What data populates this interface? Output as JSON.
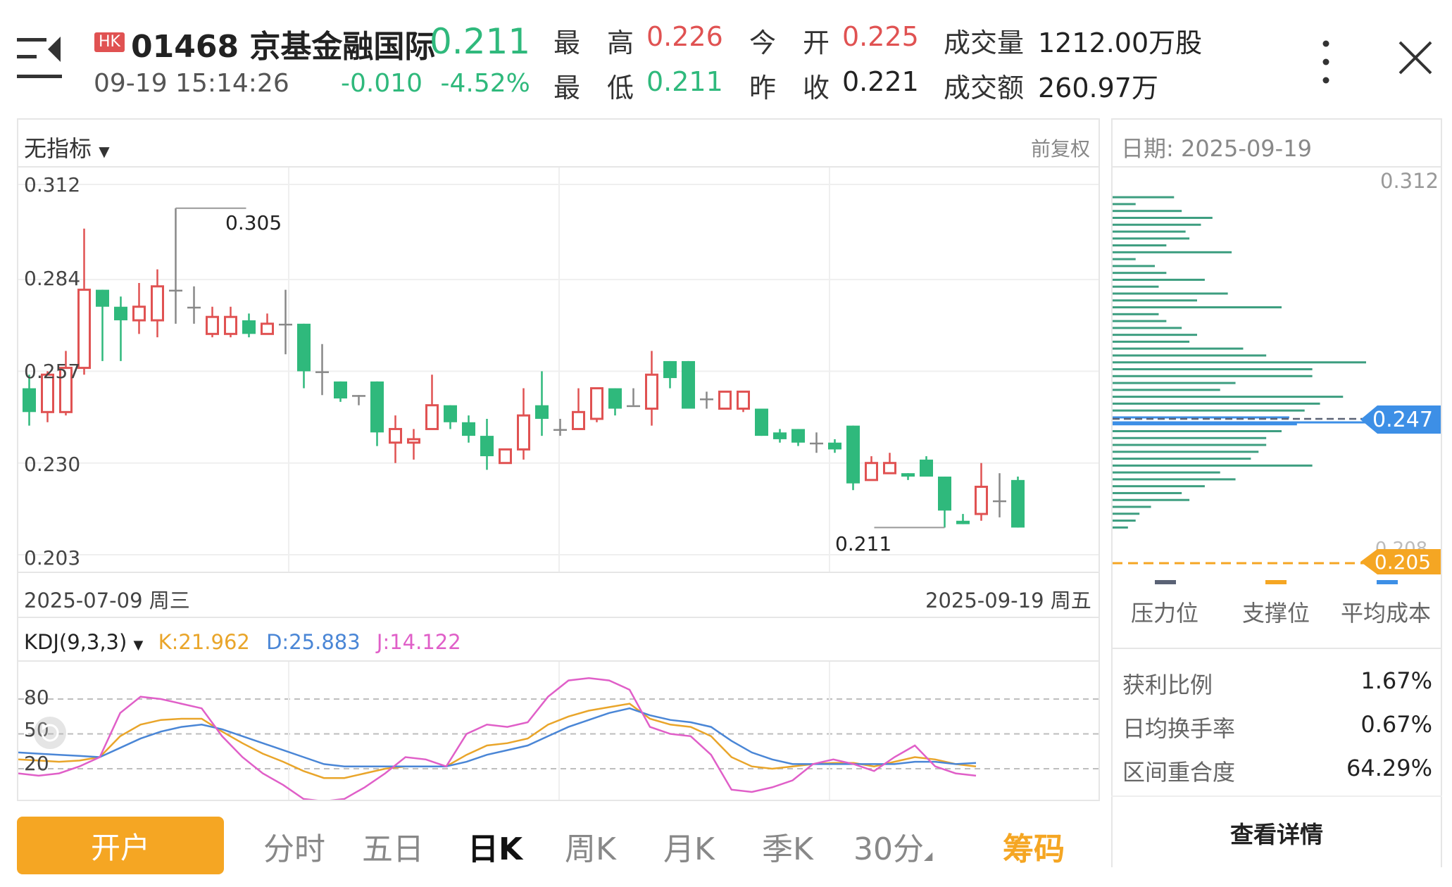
{
  "header": {
    "market_badge": "HK",
    "title": "01468 京基金融国际",
    "price": "0.211",
    "time": "09-19 15:14:26",
    "change": "-0.010",
    "change_pct": "-4.52%",
    "quotes": {
      "high_label": "最　高",
      "high": "0.226",
      "open_label": "今　开",
      "open": "0.225",
      "low_label": "最　低",
      "low": "0.211",
      "prev_close_label": "昨　收",
      "prev_close": "0.221",
      "volume_label": "成交量",
      "volume": "1212.00万股",
      "turnover_label": "成交额",
      "turnover": "260.97万"
    }
  },
  "chart_toolbar": {
    "indicator": "无指标",
    "adjust": "前复权"
  },
  "chart_data": [
    {
      "type": "candlestick",
      "y_ticks": [
        "0.312",
        "0.284",
        "0.257",
        "0.230",
        "0.203"
      ],
      "ylim": [
        0.203,
        0.312
      ],
      "x_start_label": "2025-07-09 周三",
      "x_end_label": "2025-09-19 周五",
      "high_marker": "0.305",
      "low_marker": "0.211",
      "candles": [
        [
          0.252,
          0.245,
          0.256,
          0.241
        ],
        [
          0.245,
          0.256,
          0.257,
          0.242
        ],
        [
          0.245,
          0.258,
          0.263,
          0.244
        ],
        [
          0.258,
          0.281,
          0.299,
          0.256
        ],
        [
          0.281,
          0.276,
          0.281,
          0.26
        ],
        [
          0.276,
          0.272,
          0.279,
          0.26
        ],
        [
          0.272,
          0.276,
          0.283,
          0.268
        ],
        [
          0.272,
          0.282,
          0.287,
          0.267
        ],
        [
          0.281,
          0.281,
          0.305,
          0.271
        ],
        [
          0.276,
          0.276,
          0.282,
          0.271
        ],
        [
          0.268,
          0.273,
          0.276,
          0.267
        ],
        [
          0.268,
          0.273,
          0.276,
          0.267
        ],
        [
          0.272,
          0.268,
          0.274,
          0.267
        ],
        [
          0.268,
          0.271,
          0.274,
          0.268
        ],
        [
          0.271,
          0.271,
          0.281,
          0.262
        ],
        [
          0.271,
          0.257,
          0.271,
          0.252
        ],
        [
          0.257,
          0.257,
          0.265,
          0.25
        ],
        [
          0.254,
          0.249,
          0.254,
          0.248
        ],
        [
          0.25,
          0.25,
          0.25,
          0.247
        ],
        [
          0.254,
          0.239,
          0.254,
          0.235
        ],
        [
          0.236,
          0.24,
          0.244,
          0.23
        ],
        [
          0.236,
          0.237,
          0.24,
          0.231
        ],
        [
          0.24,
          0.247,
          0.256,
          0.24
        ],
        [
          0.247,
          0.242,
          0.247,
          0.24
        ],
        [
          0.242,
          0.238,
          0.244,
          0.236
        ],
        [
          0.238,
          0.232,
          0.243,
          0.228
        ],
        [
          0.23,
          0.234,
          0.234,
          0.23
        ],
        [
          0.234,
          0.244,
          0.252,
          0.231
        ],
        [
          0.247,
          0.243,
          0.257,
          0.238
        ],
        [
          0.24,
          0.24,
          0.243,
          0.238
        ],
        [
          0.24,
          0.245,
          0.252,
          0.24
        ],
        [
          0.243,
          0.252,
          0.252,
          0.242
        ],
        [
          0.252,
          0.246,
          0.252,
          0.244
        ],
        [
          0.247,
          0.247,
          0.252,
          0.247
        ],
        [
          0.246,
          0.256,
          0.263,
          0.241
        ],
        [
          0.26,
          0.255,
          0.26,
          0.252
        ],
        [
          0.26,
          0.246,
          0.26,
          0.246
        ],
        [
          0.249,
          0.249,
          0.251,
          0.246
        ],
        [
          0.246,
          0.251,
          0.251,
          0.246
        ],
        [
          0.246,
          0.251,
          0.251,
          0.245
        ],
        [
          0.246,
          0.238,
          0.246,
          0.238
        ],
        [
          0.239,
          0.237,
          0.24,
          0.236
        ],
        [
          0.24,
          0.236,
          0.24,
          0.235
        ],
        [
          0.236,
          0.236,
          0.239,
          0.233
        ],
        [
          0.236,
          0.234,
          0.237,
          0.233
        ],
        [
          0.241,
          0.224,
          0.241,
          0.222
        ],
        [
          0.225,
          0.23,
          0.232,
          0.225
        ],
        [
          0.227,
          0.23,
          0.233,
          0.227
        ],
        [
          0.227,
          0.226,
          0.227,
          0.225
        ],
        [
          0.231,
          0.226,
          0.232,
          0.226
        ],
        [
          0.226,
          0.216,
          0.226,
          0.211
        ],
        [
          0.213,
          0.212,
          0.215,
          0.212
        ],
        [
          0.215,
          0.223,
          0.23,
          0.213
        ],
        [
          0.219,
          0.219,
          0.227,
          0.214
        ],
        [
          0.225,
          0.211,
          0.226,
          0.211
        ]
      ]
    },
    {
      "type": "line",
      "indicator": "KDJ(9,3,3)",
      "y_ticks": [
        "80",
        "50",
        "20"
      ],
      "ylim": [
        0,
        100
      ],
      "latest": {
        "K": "K:21.962",
        "D": "D:25.883",
        "J": "J:14.122"
      },
      "colors": {
        "K": "#e9a52a",
        "D": "#4a86d6",
        "J": "#e05fc8"
      },
      "series": [
        {
          "name": "K",
          "values": [
            28,
            27,
            26,
            27,
            30,
            48,
            58,
            62,
            63,
            63,
            52,
            42,
            33,
            26,
            18,
            12,
            12,
            16,
            20,
            22,
            22,
            22,
            32,
            40,
            42,
            46,
            58,
            65,
            70,
            73,
            76,
            63,
            58,
            56,
            48,
            30,
            22,
            20,
            22,
            24,
            25,
            25,
            22,
            26,
            30,
            28,
            24,
            22
          ]
        },
        {
          "name": "D",
          "values": [
            34,
            33,
            32,
            31,
            30,
            38,
            46,
            52,
            56,
            58,
            54,
            48,
            42,
            36,
            30,
            24,
            22,
            22,
            22,
            22,
            22,
            22,
            26,
            32,
            36,
            40,
            48,
            56,
            62,
            68,
            72,
            66,
            62,
            60,
            56,
            44,
            34,
            28,
            24,
            24,
            24,
            24,
            24,
            24,
            26,
            26,
            24,
            25
          ]
        },
        {
          "name": "J",
          "values": [
            16,
            14,
            16,
            22,
            30,
            68,
            82,
            80,
            76,
            72,
            48,
            30,
            16,
            6,
            -6,
            -8,
            -6,
            4,
            16,
            30,
            28,
            22,
            50,
            58,
            56,
            60,
            82,
            96,
            98,
            96,
            88,
            56,
            50,
            48,
            32,
            2,
            0,
            4,
            10,
            24,
            28,
            24,
            18,
            30,
            40,
            22,
            16,
            14
          ]
        }
      ]
    }
  ],
  "chip_panel": {
    "date": "日期: 2025-09-19",
    "top_price": "0.312",
    "avg_cost_tag": "0.247",
    "support_tag": "0.205",
    "hidden_tag": "0.208",
    "distribution": [
      0.2,
      0.05,
      0.15,
      0.3,
      0.5,
      0.45,
      0.8,
      0.3,
      0.9,
      1.3,
      1.15,
      0.95,
      1.0,
      0.7,
      1.55,
      0.3,
      0.55,
      0.7,
      1.2,
      0.6,
      1.5,
      1.1,
      2.2,
      0.6,
      0.7,
      0.9,
      1.1,
      1.0,
      1.7,
      2.0,
      3.3,
      2.6,
      2.6,
      1.6,
      1.4,
      3.0,
      2.7,
      2.5,
      2.3,
      2.4,
      2.2,
      2.0,
      2.0,
      1.9,
      1.8,
      2.6,
      1.4,
      1.6,
      1.2,
      0.9,
      1.0,
      0.5,
      0.35,
      0.3,
      0.2
    ],
    "legend": [
      {
        "label": "压力位",
        "color": "#5a6275"
      },
      {
        "label": "支撑位",
        "color": "#f5a623"
      },
      {
        "label": "平均成本",
        "color": "#3d8fe6"
      }
    ],
    "stats": [
      {
        "label": "获利比例",
        "value": "1.67%"
      },
      {
        "label": "日均换手率",
        "value": "0.67%"
      },
      {
        "label": "区间重合度",
        "value": "64.29%"
      }
    ],
    "detail_button": "查看详情"
  },
  "bottom_bar": {
    "open_account": "开户",
    "tabs": [
      "分时",
      "五日",
      "日K",
      "周K",
      "月K",
      "季K",
      "30分"
    ],
    "active_tab": "日K",
    "chip_tab": "筹码"
  },
  "colors": {
    "up": "#e05252",
    "down": "#2fb97c",
    "accent": "#f5a623",
    "avg": "#3d8fe6"
  }
}
